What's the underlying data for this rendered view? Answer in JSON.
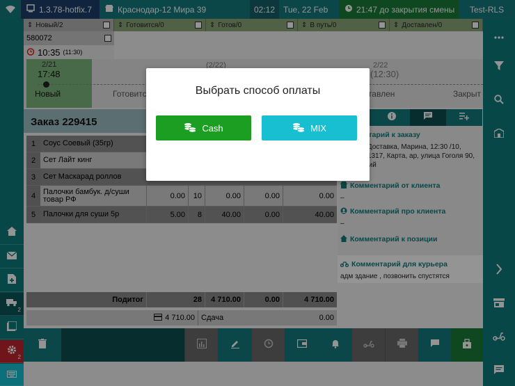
{
  "topbar": {
    "version": "1.3.78-hotfix.7",
    "store": "Краснодар-12 Мира 39",
    "time": "02:12",
    "date": "Tue, 22 Feb",
    "shift": "21:47 до закрытия смены",
    "user": "Test-RLS"
  },
  "status_tabs": [
    {
      "label": "Новый/2"
    },
    {
      "label": "Готовится/0"
    },
    {
      "label": "Готов/0"
    },
    {
      "label": "В путь/0"
    },
    {
      "label": "Доставлен/0"
    }
  ],
  "order_list": {
    "order_id": "580072",
    "time": "10:35",
    "time_small": "(11:30)"
  },
  "timeline": {
    "active_count": "2/21",
    "active_time": "17:48",
    "stages": [
      "Новый",
      "Готовится",
      "Доставлен",
      "Закрыт"
    ],
    "right_count": "2/22",
    "right_time": "(12:30)",
    "mid_count": "(2/22)"
  },
  "order": {
    "title": "Заказ 229415",
    "items": [
      {
        "num": "1",
        "name": "Соус Соевый (35гр)",
        "price": "",
        "qty": "",
        "sum": "",
        "disc": "",
        "total": ""
      },
      {
        "num": "2",
        "name": "Сет Лайт кинг",
        "price": "",
        "qty": "",
        "sum": "",
        "disc": "",
        "total": ""
      },
      {
        "num": "3",
        "name": "Сет Маскарад роллов",
        "price": "",
        "qty": "",
        "sum": "",
        "disc": "",
        "total": ""
      },
      {
        "num": "4",
        "name": "Палочки бамбук. д/суши товар РФ",
        "price": "0.00",
        "qty": "10",
        "sum": "0.00",
        "disc": "0.00",
        "total": "0.00"
      },
      {
        "num": "5",
        "name": "Палочки для суши 5р",
        "price": "5.00",
        "qty": "8",
        "sum": "40.00",
        "disc": "0.00",
        "total": "40.00"
      }
    ],
    "subtotal": {
      "label": "Подитог",
      "qty": "28",
      "sum": "4 710.00",
      "disc": "0.00",
      "total": "4 710.00"
    },
    "paid": {
      "amount": "4 710.00",
      "change_label": "Сдача",
      "change": "0.00"
    }
  },
  "comments": {
    "order_comment_title": "Комментарий к заказу",
    "order_comment_text": "ненной, Доставка, Марина, 12:30 /10, 79892981317, Карта, ар, улица Гоголя 90, нарушений",
    "client_comment_title": "Комментарий от клиента",
    "client_comment_text": "–",
    "about_client_title": "Комментарий про клиента",
    "about_client_text": "–",
    "position_comment_title": "Комментарий к позиции",
    "courier_comment_title": "Комментарий для курьера",
    "courier_comment_text": "адм здание , позвонить спустятся"
  },
  "modal": {
    "title": "Выбрать способ оплаты",
    "cash_label": "Cash",
    "mix_label": "MIX"
  },
  "colors": {
    "teal": "#137a7c",
    "cash_green": "#1b9e22",
    "mix_cyan": "#17bfd0"
  }
}
